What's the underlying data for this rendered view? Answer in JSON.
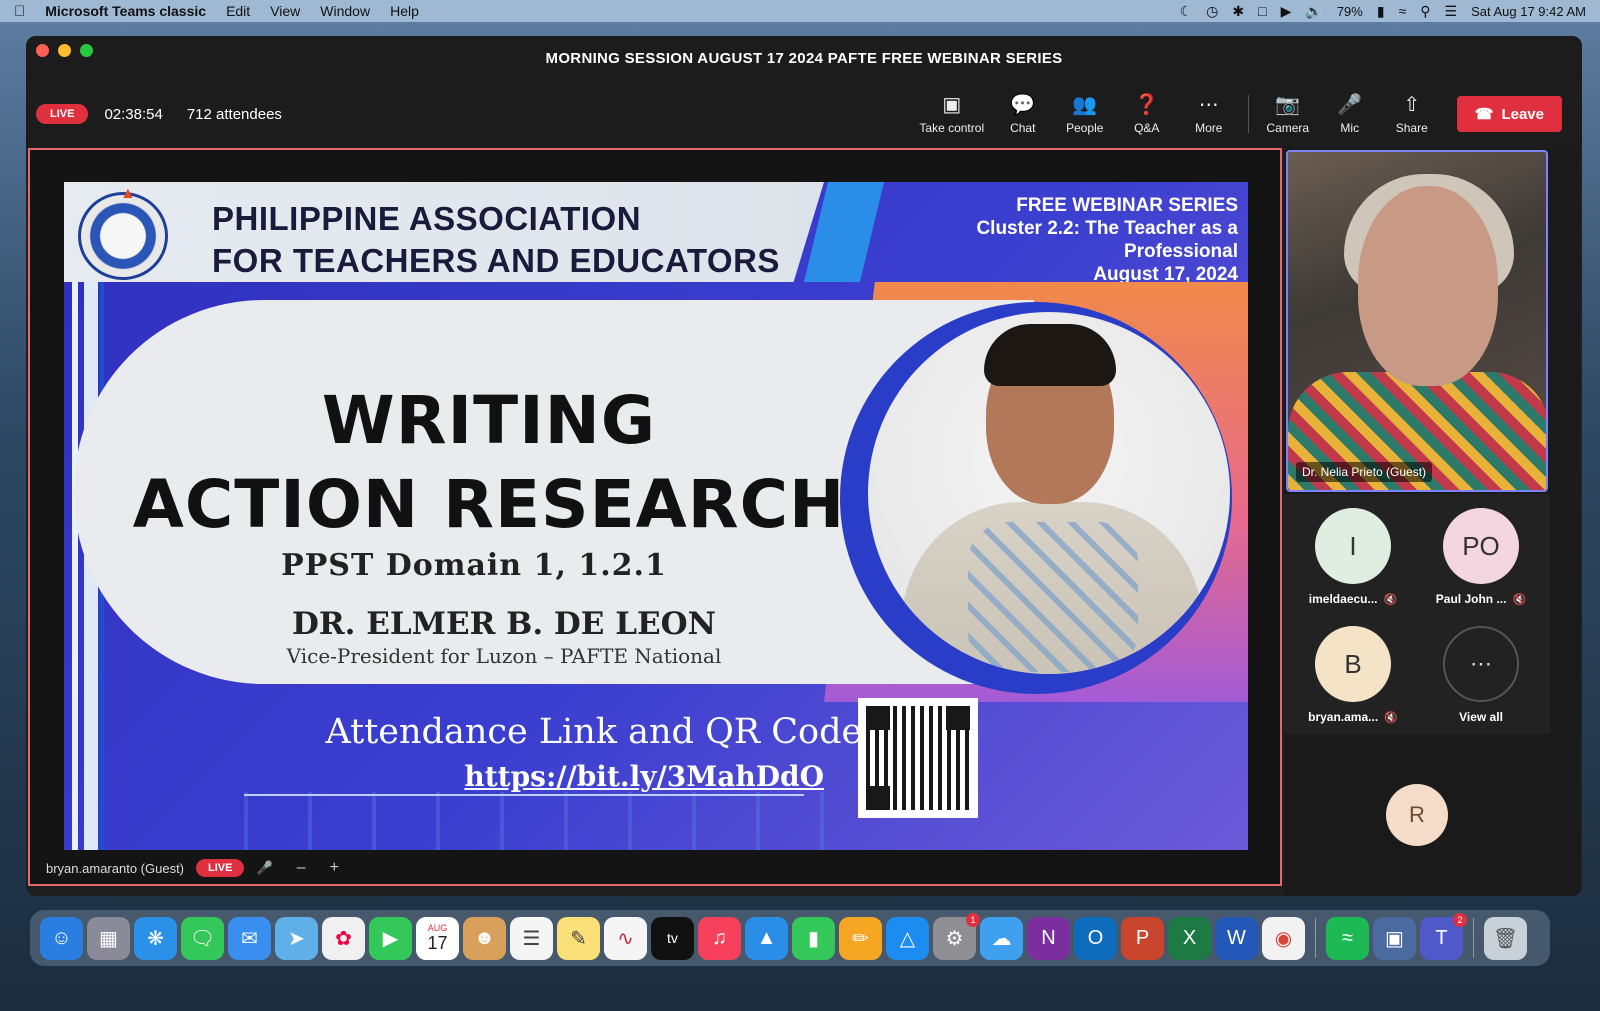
{
  "menubar": {
    "app_name": "Microsoft Teams classic",
    "menus": [
      "Edit",
      "View",
      "Window",
      "Help"
    ],
    "battery": "79%",
    "datetime": "Sat Aug 17  9:42 AM"
  },
  "window": {
    "title": "MORNING SESSION AUGUST 17 2024 PAFTE FREE WEBINAR SERIES"
  },
  "toolbar": {
    "live_label": "LIVE",
    "timer": "02:38:54",
    "attendees": "712 attendees",
    "buttons": {
      "take_control": "Take control",
      "chat": "Chat",
      "people": "People",
      "qa": "Q&A",
      "more": "More",
      "camera": "Camera",
      "mic": "Mic",
      "share": "Share"
    },
    "leave": "Leave"
  },
  "slide": {
    "org_line1": "PHILIPPINE ASSOCIATION",
    "org_line2": "FOR TEACHERS AND EDUCATORS",
    "series_title": "FREE WEBINAR SERIES",
    "series_cluster": "Cluster 2.2: The Teacher as a",
    "series_cluster2": "Professional",
    "series_date": "August 17, 2024",
    "title_line1": "WRITING",
    "title_line2": "ACTION RESEARCH",
    "subtitle": "PPST Domain 1, 1.2.1",
    "speaker": "DR. ELMER B. DE LEON",
    "position": "Vice-President for Luzon – PAFTE National",
    "attendance_label": "Attendance Link and QR Code:",
    "attendance_link": "https://bit.ly/3MahDdO"
  },
  "stage_footer": {
    "presenter": "bryan.amaranto (Guest)",
    "live_label": "LIVE",
    "zoom_out": "–",
    "zoom_in": "+"
  },
  "participants": {
    "video_name": "Dr. Nelia Prieto (Guest)",
    "tiles": [
      {
        "initials": "I",
        "name": "imeldaecu...",
        "color": "#dfeee0"
      },
      {
        "initials": "PO",
        "name": "Paul John ...",
        "color": "#f3d6e0"
      },
      {
        "initials": "B",
        "name": "bryan.ama...",
        "color": "#f5e3c8"
      }
    ],
    "view_all": "View all",
    "extra_initials": "R"
  },
  "dock": {
    "calendar_month": "AUG",
    "calendar_day": "17",
    "appletv": "tv",
    "settings_badge": "1",
    "teams_badge": "2"
  }
}
